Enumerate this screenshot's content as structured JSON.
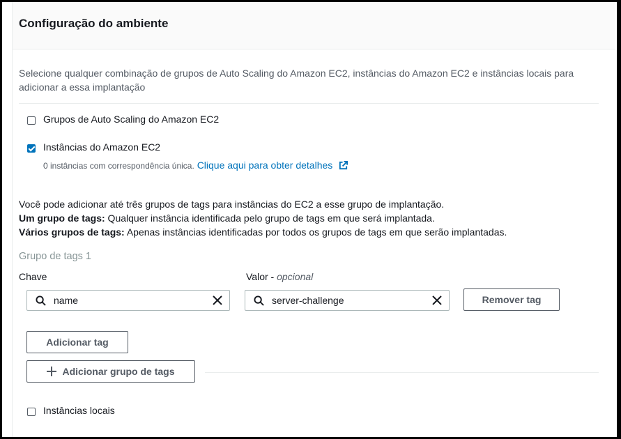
{
  "panel": {
    "title": "Configuração do ambiente",
    "description": "Selecione qualquer combinação de grupos de Auto Scaling do Amazon EC2, instâncias do Amazon EC2 e instâncias locais para adicionar a essa implantação"
  },
  "options": {
    "asg": {
      "label": "Grupos de Auto Scaling do Amazon EC2",
      "checked": false
    },
    "ec2": {
      "label": "Instâncias do Amazon EC2",
      "checked": true,
      "match_text": "0 instâncias com correspondência única.",
      "details_link": "Clique aqui para obter detalhes"
    },
    "onprem": {
      "label": "Instâncias locais",
      "checked": false
    }
  },
  "info": {
    "line1": "Você pode adicionar até três grupos de tags para instâncias do EC2 a esse grupo de implantação.",
    "line2_bold": "Um grupo de tags:",
    "line2_rest": " Qualquer instância identificada pelo grupo de tags em que será implantada.",
    "line3_bold": "Vários grupos de tags:",
    "line3_rest": " Apenas instâncias identificadas por todos os grupos de tags em que serão implantadas."
  },
  "tag_group": {
    "title": "Grupo de tags 1",
    "key_label": "Chave",
    "value_label": "Valor - ",
    "value_optional": "opcional",
    "key_value": "name",
    "value_value": "server-challenge",
    "remove_tag": "Remover tag",
    "add_tag": "Adicionar tag",
    "add_group": "Adicionar grupo de tags"
  },
  "icons": {
    "search": "search-icon",
    "clear": "close-icon",
    "external": "external-link-icon",
    "add": "plus-icon"
  },
  "colors": {
    "accent": "#0073bb",
    "text": "#16191f",
    "muted": "#545b64"
  }
}
